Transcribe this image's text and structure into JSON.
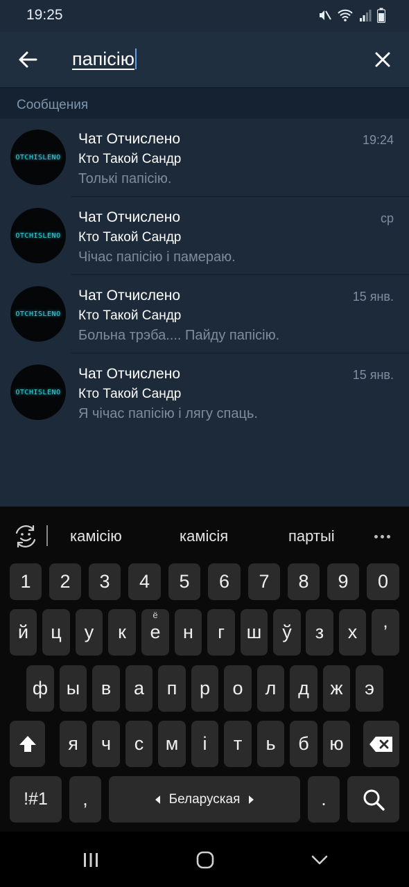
{
  "status_bar": {
    "time": "19:25"
  },
  "search": {
    "query": "папісію"
  },
  "section": {
    "label": "Сообщения"
  },
  "results": [
    {
      "title": "Чат Отчислено",
      "date": "19:24",
      "sender": "Кто Такой Сандр",
      "text": "Толькі папісію.",
      "avatar_text": "OTCHISLENO"
    },
    {
      "title": "Чат Отчислено",
      "date": "ср",
      "sender": "Кто Такой Сандр",
      "text": "Чічас папісію і памераю.",
      "avatar_text": "OTCHISLENO"
    },
    {
      "title": "Чат Отчислено",
      "date": "15 янв.",
      "sender": "Кто Такой Сандр",
      "text": "Больна трэба.... Пайду папісію.",
      "avatar_text": "OTCHISLENO"
    },
    {
      "title": "Чат Отчислено",
      "date": "15 янв.",
      "sender": "Кто Такой Сандр",
      "text": "Я чічас папісію і лягу спаць.",
      "avatar_text": "OTCHISLENO"
    }
  ],
  "keyboard": {
    "suggestions": [
      "камісію",
      "камісія",
      "партыі"
    ],
    "rows": [
      [
        "1",
        "2",
        "3",
        "4",
        "5",
        "6",
        "7",
        "8",
        "9",
        "0"
      ],
      [
        "й",
        "ц",
        "у",
        "к",
        "е",
        "н",
        "г",
        "ш",
        "ў",
        "з",
        "х",
        "’"
      ],
      [
        "ф",
        "ы",
        "в",
        "а",
        "п",
        "р",
        "о",
        "л",
        "д",
        "ж",
        "э"
      ],
      [
        "я",
        "ч",
        "с",
        "м",
        "і",
        "т",
        "ь",
        "б",
        "ю"
      ]
    ],
    "e_hint": "ё",
    "symbols_label": "!#1",
    "comma": ",",
    "space_label": "Беларуская",
    "period": "."
  },
  "colors": {
    "app_bg": "#1c2a3a",
    "header_bg": "#1f2f40",
    "section_bg": "#152231",
    "accent": "#5ea3e6",
    "avatar_glow": "#2fd6e0",
    "keyboard_bg": "#0a0a0a",
    "key_bg": "#2b2b2b"
  }
}
